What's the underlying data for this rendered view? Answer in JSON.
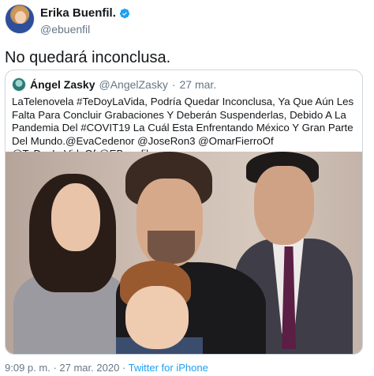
{
  "author": {
    "display_name": "Erika Buenfil.",
    "handle": "@ebuenfil",
    "verified": true
  },
  "tweet": {
    "text": "No quedará inconclusa."
  },
  "quoted_tweet": {
    "display_name": "Ángel Zasky",
    "handle": "@AngelZasky",
    "separator": "·",
    "date": "27 mar.",
    "text": "LaTelenovela #TeDoyLaVida, Podría Quedar Inconclusa, Ya Que Aún Les Falta Para Concluir Grabaciones Y Deberán Suspenderlas, Debido A La Pandemia Del #COVIT19 La Cuál Esta Enfrentando México Y Gran Parte Del Mundo.@EvaCedenor @JoseRon3 @OmarFierroOf @TeDoyLaVidaOf @EBuenfil."
  },
  "footer": {
    "time": "9:09 p. m.",
    "separator": "·",
    "date": "27 mar. 2020",
    "separator2": "·",
    "source": "Twitter for iPhone"
  },
  "colors": {
    "link": "#1da1f2",
    "secondary_text": "#657786",
    "border": "#ccd6dd"
  }
}
